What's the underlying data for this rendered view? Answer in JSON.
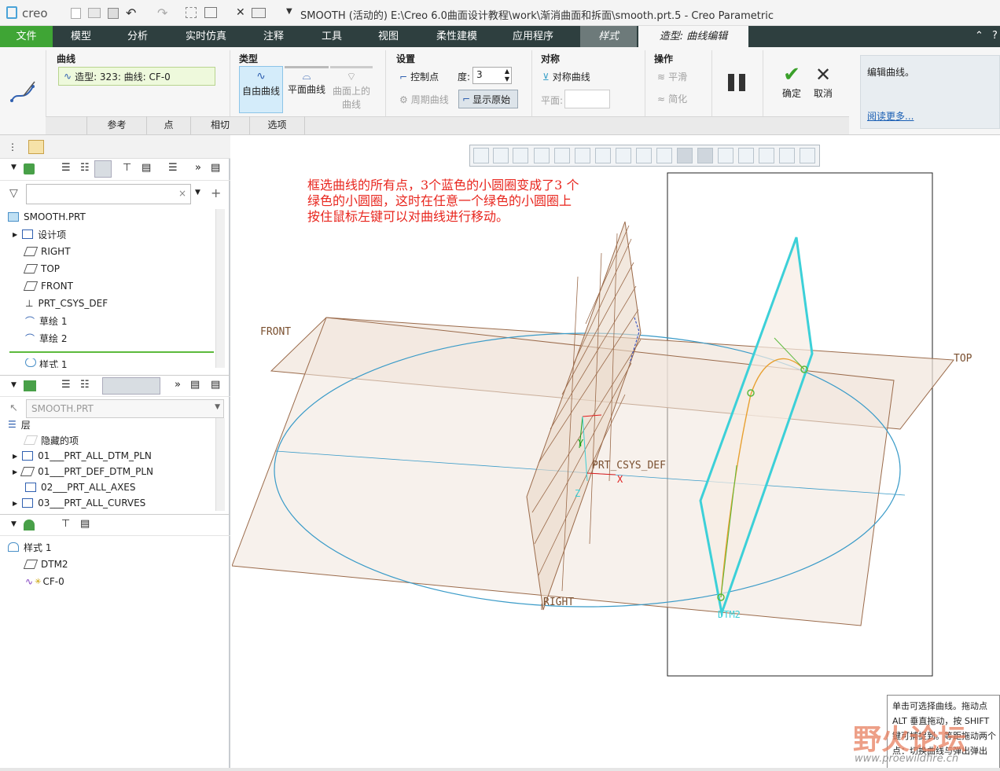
{
  "titlebar": {
    "logo": "creo",
    "title": "SMOOTH (活动的) E:\\Creo 6.0曲面设计教程\\work\\渐消曲面和拆面\\smooth.prt.5 - Creo Parametric"
  },
  "menu": {
    "file": "文件",
    "tabs": [
      "模型",
      "分析",
      "实时仿真",
      "注释",
      "工具",
      "视图",
      "柔性建模",
      "应用程序"
    ],
    "style_tab": "样式",
    "active_tab": "造型: 曲线编辑"
  },
  "ribbon": {
    "curve_group": {
      "title": "曲线",
      "value": "造型: 323: 曲线: CF-0"
    },
    "type_group": {
      "title": "类型",
      "free_curve": "自由曲线",
      "planar_curve": "平面曲线",
      "on_surface_line1": "曲面上的",
      "on_surface_line2": "曲线"
    },
    "settings_group": {
      "title": "设置",
      "control_points": "控制点",
      "degree_label": "度:",
      "degree_value": "3",
      "periodic": "周期曲线",
      "show_original": "显示原始"
    },
    "symmetry_group": {
      "title": "对称",
      "symmetric_curve": "对称曲线",
      "plane_label": "平面:"
    },
    "operation_group": {
      "title": "操作",
      "smooth": "平滑",
      "simplify": "简化"
    },
    "confirm": "确定",
    "cancel": "取消",
    "subtabs": [
      "参考",
      "点",
      "相切",
      "选项"
    ],
    "help": {
      "text": "编辑曲线。",
      "link": "阅读更多..."
    }
  },
  "model_tree": {
    "root": "SMOOTH.PRT",
    "items": [
      "设计项",
      "RIGHT",
      "TOP",
      "FRONT",
      "PRT_CSYS_DEF",
      "草绘 1",
      "草绘 2",
      "样式 1"
    ]
  },
  "layer_tree": {
    "selector": "SMOOTH.PRT",
    "root": "层",
    "items": [
      "隐藏的项",
      "01___PRT_ALL_DTM_PLN",
      "01___PRT_DEF_DTM_PLN",
      "02___PRT_ALL_AXES",
      "03___PRT_ALL_CURVES"
    ]
  },
  "style_tree": {
    "root": "样式 1",
    "items": [
      "DTM2",
      "CF-0"
    ]
  },
  "annotation": {
    "lines": [
      "框选曲线的所有点，3个蓝色的小圆圈变成了3 个",
      "绿色的小圆圈，这时在任意一个绿色的小圆圈上",
      "按住鼠标左键可以对曲线进行移动。"
    ],
    "color": "#e8261e"
  },
  "viewport_labels": {
    "front": "FRONT",
    "top": "TOP",
    "right": "RIGHT",
    "csys": "PRT_CSYS_DEF",
    "dtm2": "DTM2",
    "x": "X",
    "y": "Y",
    "z": "Z"
  },
  "tooltip": {
    "lines": [
      "单击可选择曲线。拖动点",
      "ALT 垂直拖动，按 SHIFT",
      "键可捕捉到。等距拖动两个",
      "点：切换曲线与弹出弹出"
    ]
  },
  "watermark": {
    "text": "野火论坛",
    "url": "www.proewildfire.cn"
  },
  "colors": {
    "menubar": "#2e3f3f",
    "file_tab": "#3fa535",
    "active_tab_bg": "#f6f6f6",
    "style_tab": "#6d7a7a",
    "plane_fill": "#f1e6dc",
    "plane_stroke": "#9a6a4a",
    "blue_curve": "#3a9bc8",
    "cyan": "#3cd0d8",
    "orange": "#e8a030",
    "green": "#5cba3c"
  }
}
